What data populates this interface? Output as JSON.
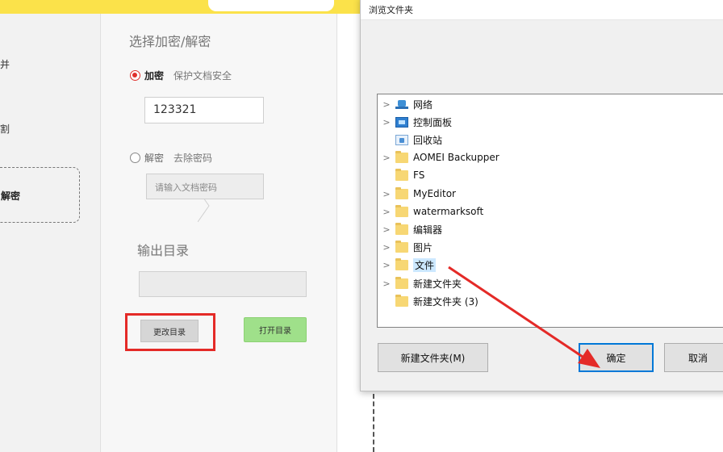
{
  "left_nav": {
    "items": [
      {
        "label": "并"
      },
      {
        "label": "割"
      },
      {
        "label": "解密",
        "selected": true
      }
    ]
  },
  "encrypt_panel": {
    "section_title": "选择加密/解密",
    "encrypt_option": {
      "label": "加密",
      "hint": "保护文档安全",
      "selected": true
    },
    "password_value": "123321",
    "decrypt_option": {
      "label": "解密",
      "hint": "去除密码",
      "selected": false
    },
    "decrypt_placeholder": "请输入文档密码",
    "output_title": "输出目录",
    "output_value": "",
    "change_dir_label": "更改目录",
    "open_dir_label": "打开目录"
  },
  "dialog": {
    "title": "浏览文件夹",
    "tree": [
      {
        "label": "网络",
        "icon": "network-icon",
        "expandable": true
      },
      {
        "label": "控制面板",
        "icon": "control-panel-icon",
        "expandable": true
      },
      {
        "label": "回收站",
        "icon": "recycle-bin-icon",
        "expandable": false
      },
      {
        "label": "AOMEI Backupper",
        "icon": "folder-icon",
        "expandable": true
      },
      {
        "label": "FS",
        "icon": "folder-icon",
        "expandable": false
      },
      {
        "label": "MyEditor",
        "icon": "folder-icon",
        "expandable": true
      },
      {
        "label": "watermarksoft",
        "icon": "folder-icon",
        "expandable": true
      },
      {
        "label": "编辑器",
        "icon": "folder-icon",
        "expandable": true
      },
      {
        "label": "图片",
        "icon": "folder-icon",
        "expandable": true
      },
      {
        "label": "文件",
        "icon": "folder-icon",
        "expandable": true,
        "selected": true
      },
      {
        "label": "新建文件夹",
        "icon": "folder-icon",
        "expandable": true
      },
      {
        "label": "新建文件夹 (3)",
        "icon": "folder-icon",
        "expandable": false
      }
    ],
    "new_folder_label": "新建文件夹(M)",
    "ok_label": "确定",
    "cancel_label": "取消"
  },
  "colors": {
    "accent_yellow": "#fbe24a",
    "highlight_red": "#e42a27",
    "open_button_green": "#9fe08a",
    "selection_blue": "#cce8ff"
  }
}
